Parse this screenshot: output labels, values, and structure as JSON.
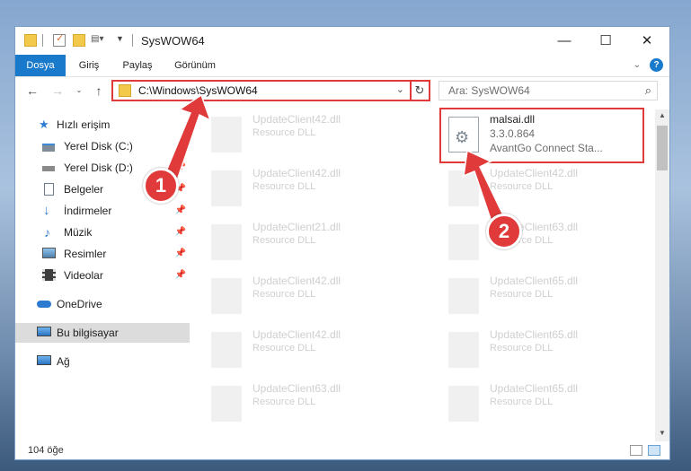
{
  "window": {
    "title": "SysWOW64",
    "controls": {
      "minimize": "—",
      "maximize": "☐",
      "close": "✕"
    }
  },
  "ribbon": {
    "tabs": [
      {
        "label": "Dosya",
        "active": true
      },
      {
        "label": "Giriş"
      },
      {
        "label": "Paylaş"
      },
      {
        "label": "Görünüm"
      }
    ]
  },
  "address": {
    "path": "C:\\Windows\\SysWOW64",
    "search_placeholder": "Ara: SysWOW64"
  },
  "sidebar": {
    "items": [
      {
        "label": "Hızlı erişim",
        "icon": "star-icon"
      },
      {
        "label": "Yerel Disk (C:)",
        "icon": "drive-icon",
        "pinned": true
      },
      {
        "label": "Yerel Disk (D:)",
        "icon": "drive-icon",
        "pinned": true
      },
      {
        "label": "Belgeler",
        "icon": "documents-icon",
        "pinned": true
      },
      {
        "label": "İndirmeler",
        "icon": "download-icon",
        "pinned": true
      },
      {
        "label": "Müzik",
        "icon": "music-icon",
        "pinned": true
      },
      {
        "label": "Resimler",
        "icon": "pictures-icon",
        "pinned": true
      },
      {
        "label": "Videolar",
        "icon": "videos-icon",
        "pinned": true
      },
      {
        "label": "OneDrive",
        "icon": "cloud-icon"
      },
      {
        "label": "Bu bilgisayar",
        "icon": "computer-icon",
        "selected": true
      },
      {
        "label": "Ağ",
        "icon": "network-icon"
      }
    ]
  },
  "files": {
    "left": [
      {
        "name": "UpdateClient42.dll",
        "desc": "Resource DLL"
      },
      {
        "name": "UpdateClient42.dll",
        "desc": "Resource DLL"
      },
      {
        "name": "UpdateClient21.dll",
        "desc": "Resource DLL"
      },
      {
        "name": "UpdateClient42.dll",
        "desc": "Resource DLL"
      },
      {
        "name": "UpdateClient42.dll",
        "desc": "Resource DLL"
      },
      {
        "name": "UpdateClient63.dll",
        "desc": "Resource DLL"
      }
    ],
    "right": [
      {
        "name": "UpdateClient42.dll",
        "desc": "Resource DLL"
      },
      {
        "name": "UpdateClient63.dll",
        "desc": "Resource DLL"
      },
      {
        "name": "UpdateClient65.dll",
        "desc": "Resource DLL"
      },
      {
        "name": "UpdateClient65.dll",
        "desc": "Resource DLL"
      },
      {
        "name": "UpdateClient65.dll",
        "desc": "Resource DLL"
      }
    ],
    "highlighted": {
      "name": "malsai.dll",
      "version": "3.3.0.864",
      "desc": "AvantGo Connect Sta..."
    }
  },
  "status": {
    "count": "104 öğe"
  },
  "callouts": {
    "one": "1",
    "two": "2"
  },
  "colors": {
    "accent": "#1979ca",
    "highlight": "#e03a3a"
  }
}
